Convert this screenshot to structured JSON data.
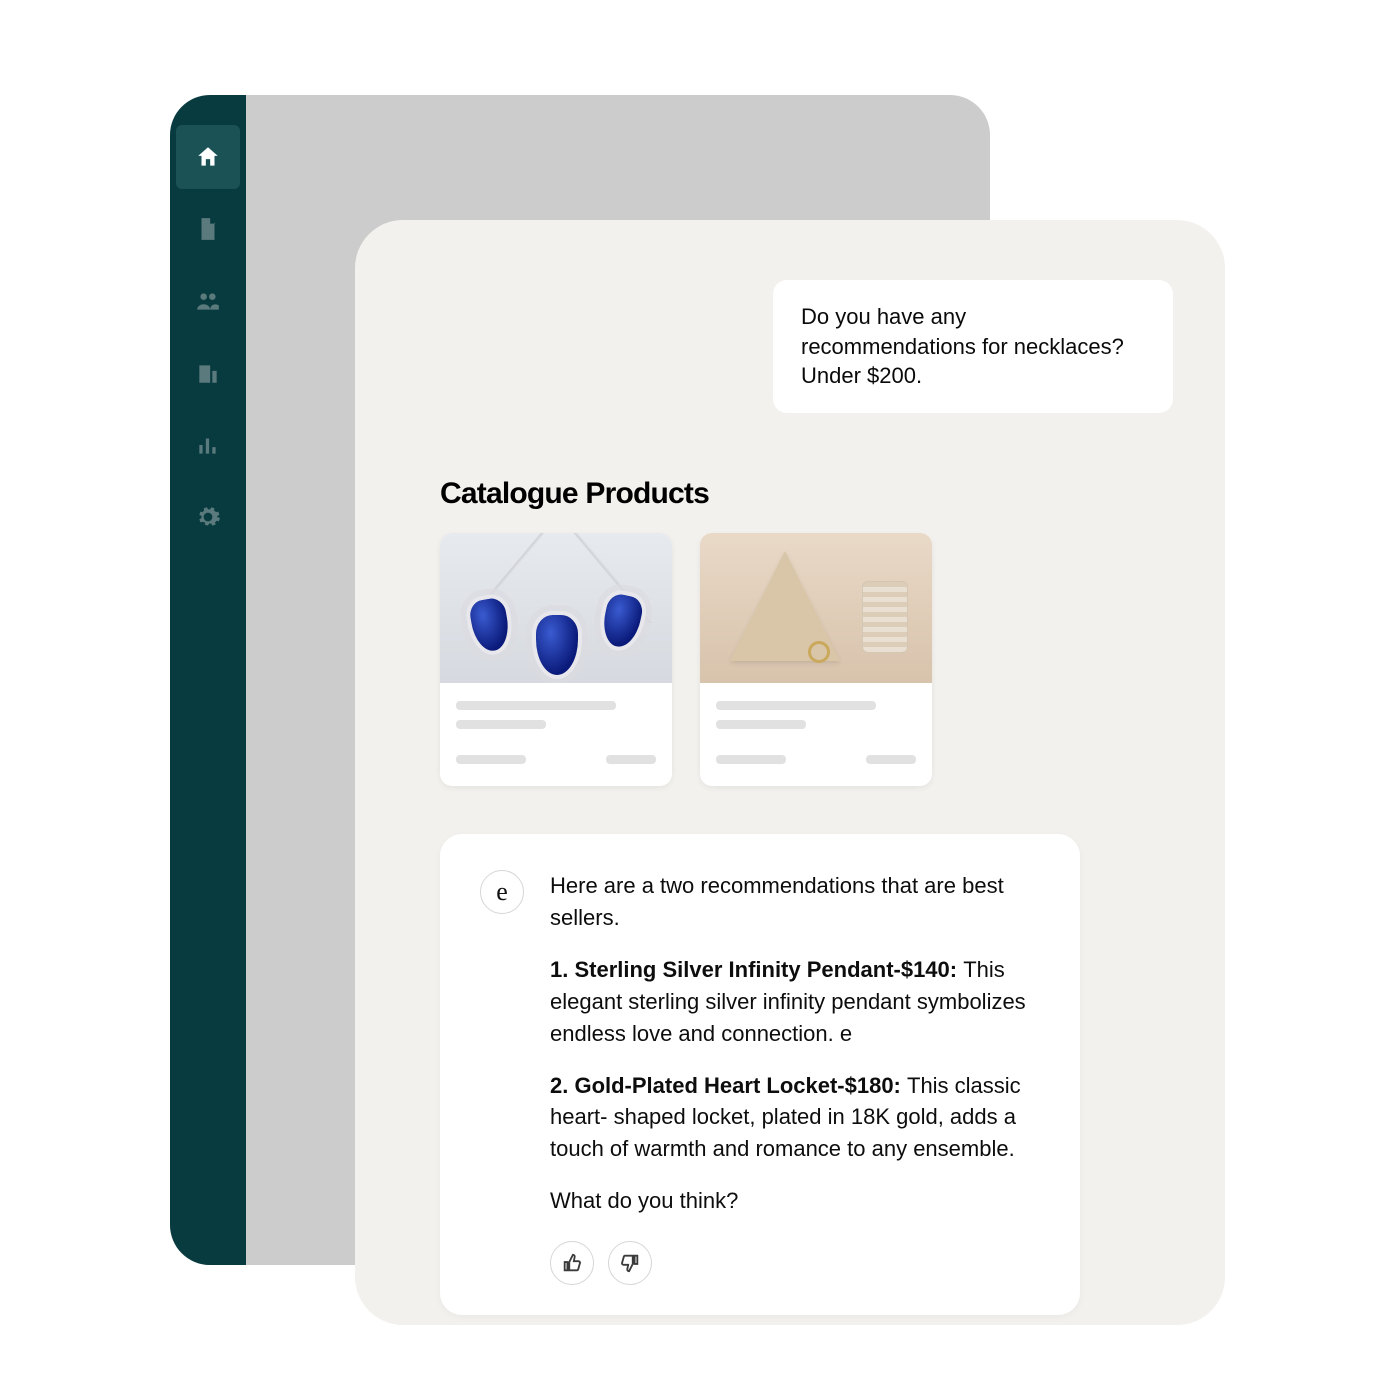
{
  "sidebar": {
    "items": [
      {
        "name": "home",
        "active": true
      },
      {
        "name": "document",
        "active": false
      },
      {
        "name": "people",
        "active": false
      },
      {
        "name": "building",
        "active": false
      },
      {
        "name": "stats",
        "active": false
      },
      {
        "name": "settings",
        "active": false
      }
    ]
  },
  "chat": {
    "user_message": "Do you have any recommendations for necklaces? Under $200.",
    "catalogue_title": "Catalogue Products",
    "assistant_avatar_letter": "e",
    "assistant_intro": "Here are a two recommendations that are best sellers.",
    "recommendation_1_bold": " 1. Sterling Silver Infinity Pendant-$140: ",
    "recommendation_1_rest": "This elegant sterling silver infinity pendant symbolizes endless love and connection. e",
    "recommendation_2_bold": " 2. Gold-Plated Heart Locket-$180: ",
    "recommendation_2_rest": "This classic heart- shaped locket, plated in 18K gold, adds a touch of warmth and romance to any ensemble.",
    "assistant_outro": "What do you think?"
  },
  "products": [
    {
      "image_style": "sapphire-set"
    },
    {
      "image_style": "beige-scene"
    }
  ],
  "icons": {
    "thumbs_up": "thumbs-up-icon",
    "thumbs_down": "thumbs-down-icon"
  }
}
